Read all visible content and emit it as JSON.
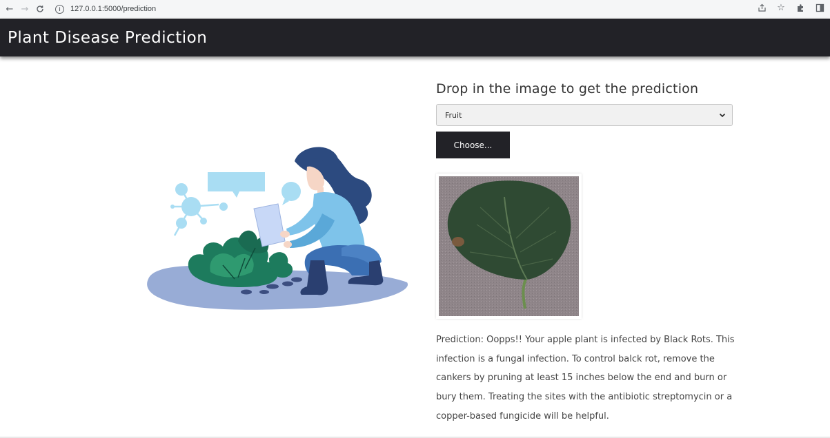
{
  "browser": {
    "url": "127.0.0.1:5000/prediction"
  },
  "header": {
    "title": "Plant Disease Prediction"
  },
  "form": {
    "heading": "Drop in the image to get the prediction",
    "select_value": "Fruit",
    "choose_label": "Choose..."
  },
  "result": {
    "text": "Prediction: Oopps!! Your apple plant is infected by Black Rots. This infection is a fungal infection. To control balck rot, remove the cankers by pruning at least 15 inches below the end and burn or bury them. Treating the sites with the antibiotic streptomycin or a copper-based fungicide will be helpful."
  },
  "colors": {
    "header_bg": "#222227",
    "button_bg": "#222227",
    "text": "#444444"
  }
}
